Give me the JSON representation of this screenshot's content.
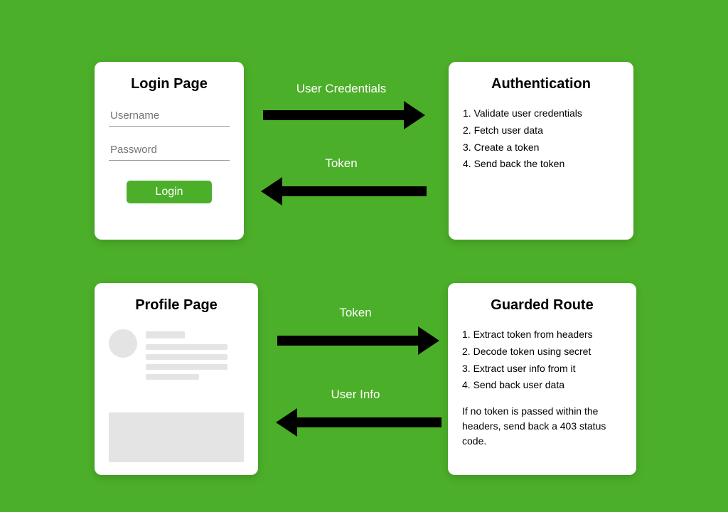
{
  "login": {
    "title": "Login Page",
    "username_placeholder": "Username",
    "password_placeholder": "Password",
    "button_label": "Login"
  },
  "auth": {
    "title": "Authentication",
    "steps": [
      "Validate user credentials",
      "Fetch user data",
      "Create a token",
      "Send back the token"
    ]
  },
  "profile": {
    "title": "Profile Page"
  },
  "guarded": {
    "title": "Guarded Route",
    "steps": [
      "Extract token from headers",
      "Decode token using secret",
      "Extract user info from it",
      "Send back user data"
    ],
    "note": "If no token is passed within the headers, send back a 403 status code."
  },
  "arrows": {
    "top_right": "User Credentials",
    "top_left": "Token",
    "bottom_right": "Token",
    "bottom_left": "User Info"
  }
}
